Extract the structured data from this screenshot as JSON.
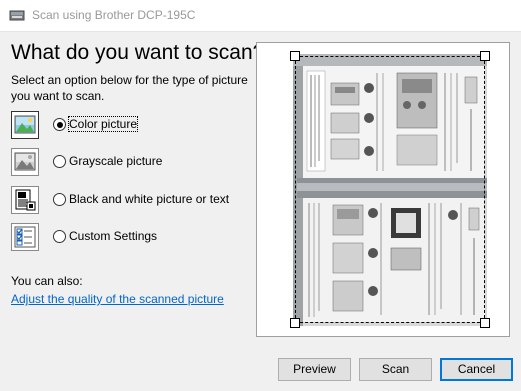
{
  "window": {
    "title": "Scan using Brother DCP-195C",
    "icon": "scanner-icon"
  },
  "main": {
    "heading": "What do you want to scan?",
    "instruction": "Select an option below for the type of picture you want to scan.",
    "options": [
      {
        "label": "Color picture",
        "icon": "color-picture-icon",
        "selected": true
      },
      {
        "label": "Grayscale picture",
        "icon": "grayscale-picture-icon",
        "selected": false
      },
      {
        "label": "Black and white picture or text",
        "icon": "black-white-text-icon",
        "selected": false
      },
      {
        "label": "Custom Settings",
        "icon": "custom-settings-icon",
        "selected": false
      }
    ],
    "also_label": "You can also:",
    "adjust_link": "Adjust the quality of the scanned picture"
  },
  "buttons": {
    "preview": "Preview",
    "scan": "Scan",
    "cancel": "Cancel"
  },
  "colors": {
    "link": "#0066cc",
    "default_button_border": "#0078d7",
    "title_text": "#999999"
  }
}
